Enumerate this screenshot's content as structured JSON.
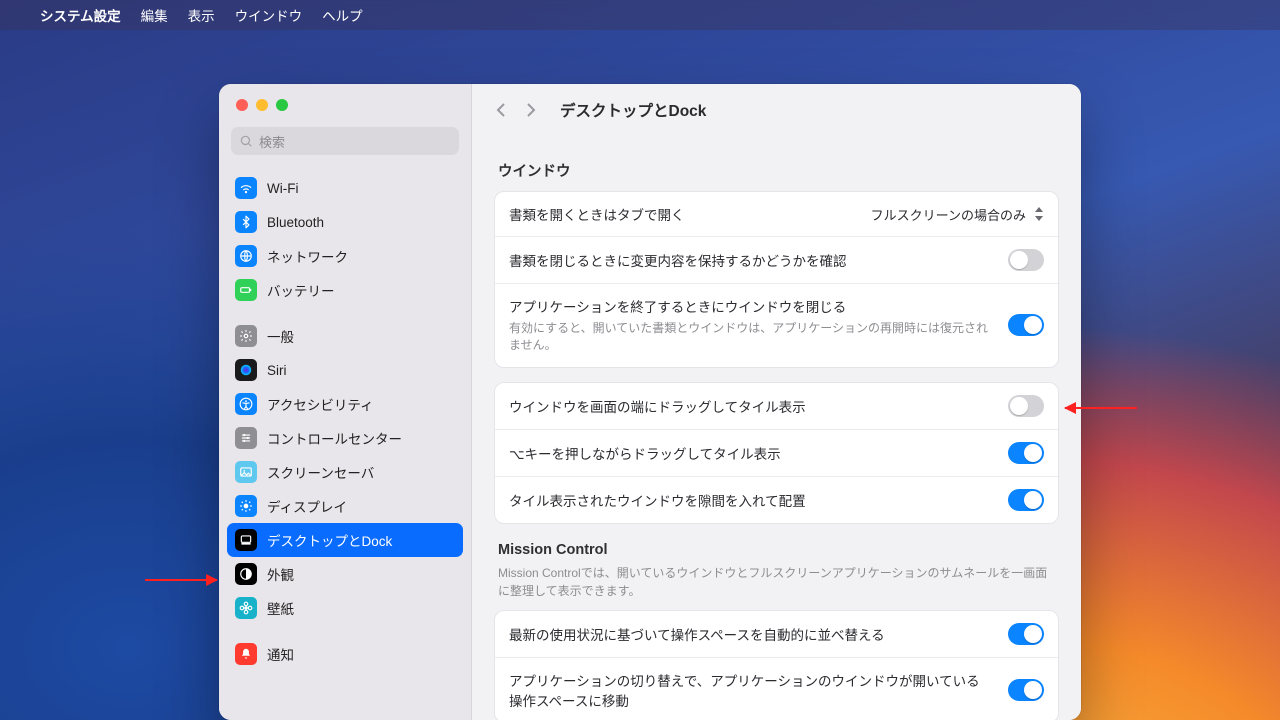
{
  "menubar": {
    "app": "システム設定",
    "items": [
      "編集",
      "表示",
      "ウインドウ",
      "ヘルプ"
    ]
  },
  "window": {
    "search_placeholder": "検索",
    "title": "デスクトップとDock"
  },
  "sidebar": {
    "items": [
      {
        "label": "Wi-Fi",
        "icon": "wifi",
        "bg": "#0a84ff"
      },
      {
        "label": "Bluetooth",
        "icon": "bluetooth",
        "bg": "#0a84ff"
      },
      {
        "label": "ネットワーク",
        "icon": "globe",
        "bg": "#0a84ff"
      },
      {
        "label": "バッテリー",
        "icon": "battery",
        "bg": "#30d158"
      },
      {
        "gap": true
      },
      {
        "label": "一般",
        "icon": "gear",
        "bg": "#8e8e93"
      },
      {
        "label": "Siri",
        "icon": "siri",
        "bg": "#1b1b1d"
      },
      {
        "label": "アクセシビリティ",
        "icon": "access",
        "bg": "#0a84ff"
      },
      {
        "label": "コントロールセンター",
        "icon": "sliders",
        "bg": "#8e8e93"
      },
      {
        "label": "スクリーンセーバ",
        "icon": "photo",
        "bg": "#5fc8ee"
      },
      {
        "label": "ディスプレイ",
        "icon": "sun",
        "bg": "#0a84ff"
      },
      {
        "label": "デスクトップとDock",
        "icon": "dock",
        "bg": "#000000",
        "selected": true
      },
      {
        "label": "外観",
        "icon": "contrast",
        "bg": "#000000"
      },
      {
        "label": "壁紙",
        "icon": "flower",
        "bg": "#17b1c9"
      },
      {
        "gap": true
      },
      {
        "label": "通知",
        "icon": "bell",
        "bg": "#ff3b30"
      }
    ]
  },
  "content": {
    "section_window_title": "ウインドウ",
    "row_tabs_label": "書類を開くときはタブで開く",
    "row_tabs_value": "フルスクリーンの場合のみ",
    "row_ask_keep_changes": "書類を閉じるときに変更内容を保持するかどうかを確認",
    "row_close_on_quit": "アプリケーションを終了するときにウインドウを閉じる",
    "row_close_on_quit_sub": "有効にすると、開いていた書類とウインドウは、アプリケーションの再開時には復元されません。",
    "row_drag_tile": "ウインドウを画面の端にドラッグしてタイル表示",
    "row_opt_tile": "⌥キーを押しながらドラッグしてタイル表示",
    "row_tile_margin": "タイル表示されたウインドウを隙間を入れて配置",
    "mc_title": "Mission Control",
    "mc_desc": "Mission Controlでは、開いているウインドウとフルスクリーンアプリケーションのサムネールを一画面に整理して表示できます。",
    "mc_row_auto_rearrange": "最新の使用状況に基づいて操作スペースを自動的に並べ替える",
    "mc_row_switch_space": "アプリケーションの切り替えで、アプリケーションのウインドウが開いている操作スペースに移動"
  },
  "toggles": {
    "ask_keep_changes": false,
    "close_on_quit": true,
    "drag_tile": false,
    "opt_tile": true,
    "tile_margin": true,
    "mc_auto_rearrange": true,
    "mc_switch_space": true
  }
}
